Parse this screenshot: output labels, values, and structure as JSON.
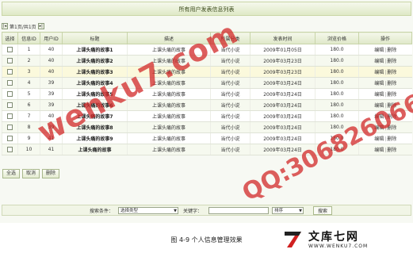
{
  "header": {
    "title": "所有用户发表信息列表"
  },
  "pager": {
    "first_icon": "first-page-icon",
    "text": "第1页/共1页",
    "next_icon": "next-page-icon"
  },
  "table": {
    "columns": [
      "选择",
      "信息ID",
      "用户ID",
      "标题",
      "描述",
      "所属分类",
      "发表时间",
      "浏览价格",
      "操作"
    ],
    "rows": [
      {
        "id": "1",
        "uid": "40",
        "title": "上课头痛的故事1",
        "desc": "上课头痛的故事",
        "cat": "当代小说",
        "time": "2009年01月05日",
        "price": "180.0",
        "edit": "编辑",
        "del": "删除"
      },
      {
        "id": "2",
        "uid": "40",
        "title": "上课头痛的故事2",
        "desc": "上课头痛的故事",
        "cat": "当代小说",
        "time": "2009年03月23日",
        "price": "180.0",
        "edit": "编辑",
        "del": "删除"
      },
      {
        "id": "3",
        "uid": "40",
        "title": "上课头痛的故事3",
        "desc": "上课头痛的故事",
        "cat": "当代小说",
        "time": "2009年03月23日",
        "price": "180.0",
        "edit": "编辑",
        "del": "删除"
      },
      {
        "id": "4",
        "uid": "39",
        "title": "上课头痛的故事4",
        "desc": "上课头痛的故事",
        "cat": "当代小说",
        "time": "2009年03月24日",
        "price": "180.0",
        "edit": "编辑",
        "del": "删除"
      },
      {
        "id": "5",
        "uid": "39",
        "title": "上课头痛的故事5",
        "desc": "上课头痛的故事",
        "cat": "当代小说",
        "time": "2009年03月24日",
        "price": "180.0",
        "edit": "编辑",
        "del": "删除"
      },
      {
        "id": "6",
        "uid": "39",
        "title": "上课头痛的故事6",
        "desc": "上课头痛的故事",
        "cat": "当代小说",
        "time": "2009年03月24日",
        "price": "180.0",
        "edit": "编辑",
        "del": "删除"
      },
      {
        "id": "7",
        "uid": "40",
        "title": "上课头痛的故事7",
        "desc": "上课头痛的故事",
        "cat": "当代小说",
        "time": "2009年03月24日",
        "price": "180.0",
        "edit": "编辑",
        "del": "删除"
      },
      {
        "id": "8",
        "uid": "39",
        "title": "上课头痛的故事8",
        "desc": "上课头痛的故事",
        "cat": "当代小说",
        "time": "2009年03月24日",
        "price": "180.0",
        "edit": "编辑",
        "del": "删除"
      },
      {
        "id": "9",
        "uid": "41",
        "title": "上课头痛的故事9",
        "desc": "上课头痛的故事",
        "cat": "当代小说",
        "time": "2009年03月24日",
        "price": "180.0",
        "edit": "编辑",
        "del": "删除"
      },
      {
        "id": "10",
        "uid": "41",
        "title": "上课头痛的故事",
        "desc": "上课头痛的故事",
        "cat": "当代小说",
        "time": "2009年03月24日",
        "price": "180.0",
        "edit": "编辑",
        "del": "删除"
      }
    ]
  },
  "bulk": {
    "select_all": "全选",
    "cancel": "取消",
    "delete": "删除"
  },
  "search": {
    "condition_label": "搜索条件：",
    "type_value": "选择类型",
    "keyword_label": "关键字：",
    "keyword_value": "",
    "sort_value": "排序",
    "search_button": "搜索"
  },
  "caption": "图 4-9  个人信息管理效果",
  "watermark": {
    "text1": "wenku7.com",
    "text2": "QQ:306826066"
  },
  "logo": {
    "cn": "文库七网",
    "url": "WWW.WENKU7.COM"
  },
  "colors": {
    "header_bg": "#dfe8c9",
    "highlight_row": "#fbf9dc",
    "watermark": "#d22828"
  }
}
